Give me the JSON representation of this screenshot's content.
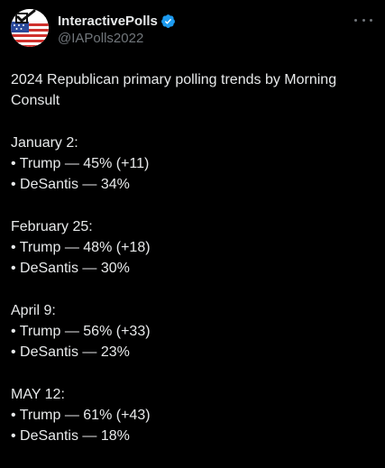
{
  "author": {
    "display_name": "InteractivePolls",
    "handle": "@IAPolls2022",
    "verified_icon": "verified-badge-icon",
    "avatar_icon": "american-flag-checkmark-icon",
    "brand_color": "#1d9bf0"
  },
  "menu": {
    "more_icon": "ellipsis-icon"
  },
  "post": {
    "intro": "2024 Republican primary polling trends by Morning Consult",
    "blocks": [
      {
        "date": "January 2:",
        "lines": [
          "• Trump — 45% (+11)",
          "• DeSantis — 34%"
        ]
      },
      {
        "date": "February 25:",
        "lines": [
          "• Trump — 48% (+18)",
          "• DeSantis — 30%"
        ]
      },
      {
        "date": "April 9:",
        "lines": [
          "• Trump — 56% (+33)",
          "• DeSantis — 23%"
        ]
      },
      {
        "date": "MAY 12:",
        "lines": [
          "• Trump — 61% (+43)",
          "• DeSantis — 18%"
        ]
      }
    ]
  }
}
